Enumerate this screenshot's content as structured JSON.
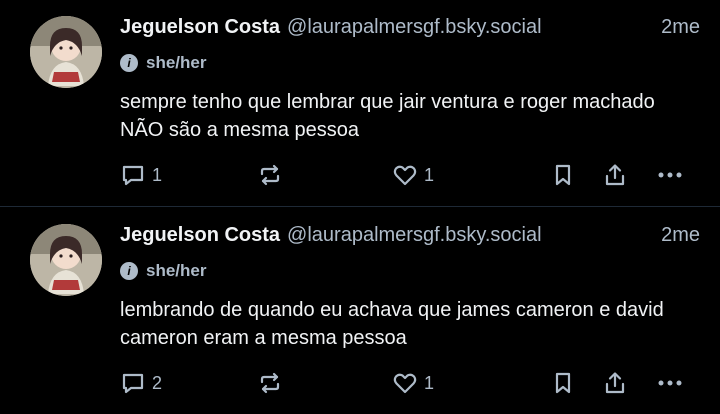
{
  "colors": {
    "background": "#000000",
    "text": "#f1f3f5",
    "muted": "#aebbc9",
    "divider": "#1e2936"
  },
  "posts": [
    {
      "author_name": "Jeguelson Costa",
      "handle": "@laurapalmersgf.bsky.social",
      "time": "2me",
      "pronouns": "she/her",
      "text": "sempre tenho que lembrar que jair ventura e roger machado NÃO são a mesma pessoa",
      "reply_count": "1",
      "like_count": "1",
      "icons": [
        "reply-icon",
        "repost-icon",
        "like-icon",
        "bookmark-icon",
        "share-icon",
        "more-icon"
      ]
    },
    {
      "author_name": "Jeguelson Costa",
      "handle": "@laurapalmersgf.bsky.social",
      "time": "2me",
      "pronouns": "she/her",
      "text": "lembrando de quando eu achava que james cameron e david cameron eram a mesma pessoa",
      "reply_count": "2",
      "like_count": "1",
      "icons": [
        "reply-icon",
        "repost-icon",
        "like-icon",
        "bookmark-icon",
        "share-icon",
        "more-icon"
      ]
    }
  ]
}
